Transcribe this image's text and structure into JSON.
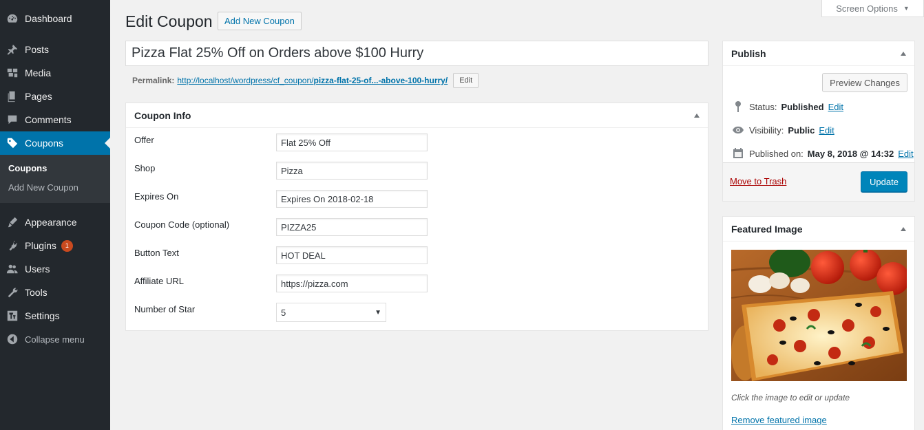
{
  "sidebar": {
    "items": [
      {
        "label": "Dashboard",
        "icon": "dashboard-icon"
      },
      {
        "label": "Posts",
        "icon": "pin-icon"
      },
      {
        "label": "Media",
        "icon": "media-icon"
      },
      {
        "label": "Pages",
        "icon": "pages-icon"
      },
      {
        "label": "Comments",
        "icon": "comment-icon"
      },
      {
        "label": "Coupons",
        "icon": "tag-icon"
      },
      {
        "label": "Appearance",
        "icon": "brush-icon"
      },
      {
        "label": "Plugins",
        "icon": "plugin-icon",
        "badge": "1"
      },
      {
        "label": "Users",
        "icon": "users-icon"
      },
      {
        "label": "Tools",
        "icon": "wrench-icon"
      },
      {
        "label": "Settings",
        "icon": "settings-icon"
      }
    ],
    "submenu": [
      "Coupons",
      "Add New Coupon"
    ],
    "collapse_label": "Collapse menu"
  },
  "screen_options": {
    "label": "Screen Options",
    "arrow": "▼"
  },
  "header": {
    "title": "Edit Coupon",
    "add_new_label": "Add New Coupon"
  },
  "post_title": "Pizza Flat 25% Off on Orders above $100 Hurry",
  "permalink": {
    "label": "Permalink:",
    "base": "http://localhost/wordpress/cf_coupon/",
    "slug": "pizza-flat-25-of...-above-100-hurry/",
    "edit_label": "Edit"
  },
  "coupon_info": {
    "title": "Coupon Info",
    "fields": [
      {
        "label": "Offer",
        "value": "Flat 25% Off"
      },
      {
        "label": "Shop",
        "value": "Pizza"
      },
      {
        "label": "Expires On",
        "value": "Expires On 2018-02-18"
      },
      {
        "label": "Coupon Code (optional)",
        "value": "PIZZA25"
      },
      {
        "label": "Button Text",
        "value": "HOT DEAL"
      },
      {
        "label": "Affiliate URL",
        "value": "https://pizza.com"
      }
    ],
    "star_label": "Number of Star",
    "star_value": "5"
  },
  "publish": {
    "title": "Publish",
    "preview_label": "Preview Changes",
    "status_label": "Status:",
    "status_value": "Published",
    "visibility_label": "Visibility:",
    "visibility_value": "Public",
    "published_label": "Published on:",
    "published_value": "May 8, 2018 @ 14:32",
    "edit_label": "Edit",
    "trash_label": "Move to Trash",
    "update_label": "Update"
  },
  "featured_image": {
    "title": "Featured Image",
    "hint": "Click the image to edit or update",
    "remove_label": "Remove featured image"
  },
  "colors": {
    "sidebar_bg": "#23282d",
    "active_bg": "#0073aa",
    "primary_button": "#0085ba",
    "link": "#0073aa",
    "trash": "#aa0000"
  }
}
